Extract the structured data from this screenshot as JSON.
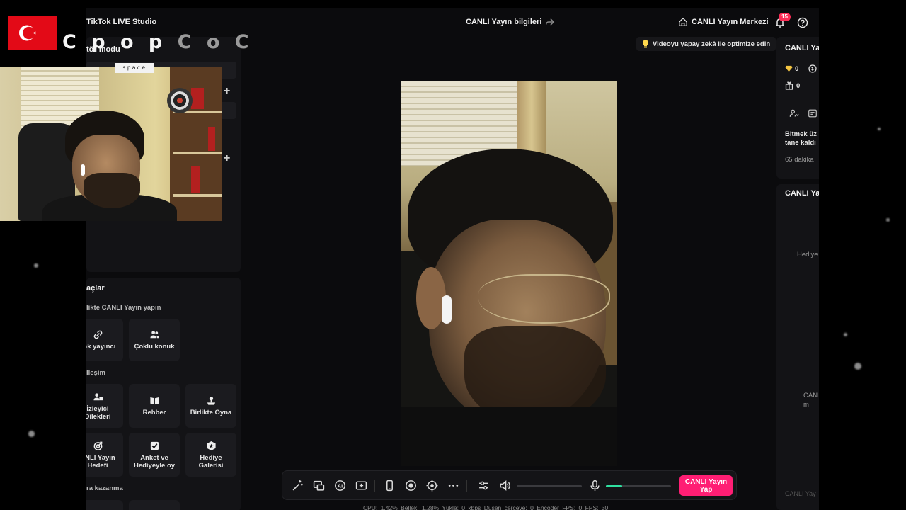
{
  "app": {
    "title": "TikTok LIVE Studio"
  },
  "header": {
    "live_info": "CANLI Yayın bilgileri",
    "live_center": "CANLI Yayın Merkezi",
    "notification_count": "15"
  },
  "left_panel": {
    "mode_title": "tör modu"
  },
  "tools": {
    "title": "açlar",
    "section_live_together": "likte CANLI Yayın yapın",
    "section_interaction": "lleşim",
    "section_earn": "ra kazanma",
    "items": [
      {
        "label": "cak yayıncı",
        "icon": "link-icon"
      },
      {
        "label": "Çoklu konuk",
        "icon": "multi-guest-icon"
      },
      {
        "label": "İzleyici Dilekleri",
        "icon": "viewer-wishes-icon"
      },
      {
        "label": "Rehber",
        "icon": "guide-icon"
      },
      {
        "label": "Birlikte Oyna",
        "icon": "play-together-icon"
      },
      {
        "label": "ANLI Yayın Hedefi",
        "icon": "live-goal-icon"
      },
      {
        "label": "Anket ve Hediyeyle oy",
        "icon": "poll-icon"
      },
      {
        "label": "Hediye Galerisi",
        "icon": "gift-gallery-icon"
      }
    ]
  },
  "center": {
    "ai_tip": "Videoyu yapay zekâ ile optimize edin"
  },
  "toolbar": {
    "go_live_label": "CANLI Yayın Yap",
    "mic_level": 0.25,
    "icons": [
      "magic-wand-icon",
      "screen-share-icon",
      "ai-icon",
      "add-source-icon",
      "phone-layout-icon",
      "record-icon",
      "camera-target-icon",
      "more-icon",
      "settings-sliders-icon",
      "speaker-icon",
      "microphone-icon"
    ]
  },
  "stats": {
    "text": "CPU: 1.42%   Bellek: 1.28%   Yükle: 0 kbps   Düşen çerçeve: 0   Encoder FPS: 0   FPS: 30"
  },
  "right_panel": {
    "title_top": "CANLI Ya",
    "diamonds": "0",
    "coins": "0",
    "gifts": "0",
    "task_text": "Bitmek üz tane kaldı",
    "minutes_text": "65 dakika",
    "title_bottom": "CANLI Ya",
    "gifts_label": "Hediye",
    "empty_text": "CAN m",
    "footer_hint": "CANLI Yay"
  },
  "overlay": {
    "brand_main": "C p o p",
    "brand_fade": "C o C",
    "space_tag": "space",
    "flag_color": "#e30a17"
  },
  "colors": {
    "accent": "#ff1e74",
    "badge": "#fe2c55",
    "mic_level": "#2fe0a0",
    "panel": "#131316",
    "background": "#0b0b0d"
  }
}
